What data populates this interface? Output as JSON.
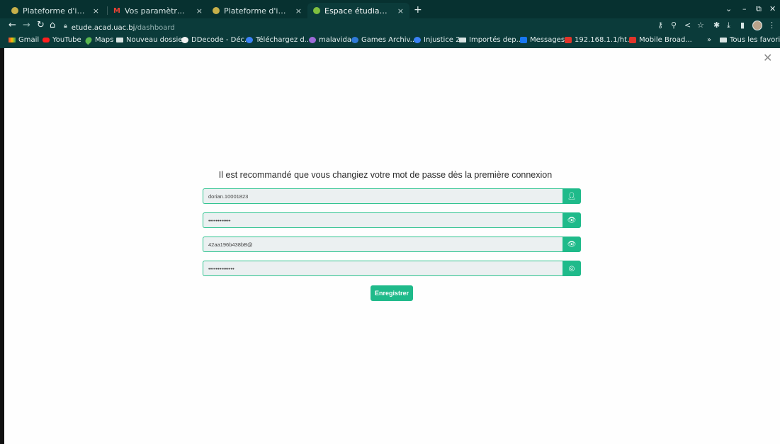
{
  "browser": {
    "tabs": [
      {
        "label": "Plateforme d'inscription",
        "favicon": "site-icon",
        "active": false
      },
      {
        "label": "Vos paramètres de comp",
        "favicon": "gmail-icon",
        "active": false
      },
      {
        "label": "Plateforme d'inscription",
        "favicon": "site-icon",
        "active": false
      },
      {
        "label": "Espace étudiant | Accueil",
        "favicon": "site-icon",
        "active": true
      }
    ],
    "new_tab": "+",
    "url_host": "etude.acad.uac.bj",
    "url_path": "/dashboard",
    "bookmarks": [
      {
        "label": "Gmail",
        "icon": "gmail-icon"
      },
      {
        "label": "YouTube",
        "icon": "youtube-icon"
      },
      {
        "label": "Maps",
        "icon": "maps-icon"
      },
      {
        "label": "Nouveau dossier",
        "icon": "folder-icon"
      },
      {
        "label": "DDecode - Déc...",
        "icon": "globe-icon"
      },
      {
        "label": "Téléchargez d...",
        "icon": "globe-icon"
      },
      {
        "label": "malavida",
        "icon": "malavida-icon"
      },
      {
        "label": "Games Archiv...",
        "icon": "globe-icon"
      },
      {
        "label": "Injustice 2",
        "icon": "globe-icon"
      },
      {
        "label": "Importés dep...",
        "icon": "folder-icon"
      },
      {
        "label": "Messages",
        "icon": "facebook-icon"
      },
      {
        "label": "192.168.1.1/ht...",
        "icon": "router-icon"
      },
      {
        "label": "Mobile Broad...",
        "icon": "router-icon"
      }
    ],
    "all_bookmarks_label": "Tous les favoris"
  },
  "form": {
    "heading": "Il est recommandé que vous changiez votre mot de passe dès la première connexion",
    "username_value": "dorian.10001823",
    "password1_value": "••••••••••••",
    "password2_value": "42aa196b438bB@",
    "password3_value": "••••••••••••••",
    "submit_label": "Enregistrer"
  },
  "colors": {
    "accent": "#1fba8a",
    "chrome_bg": "#0b3b3a"
  }
}
